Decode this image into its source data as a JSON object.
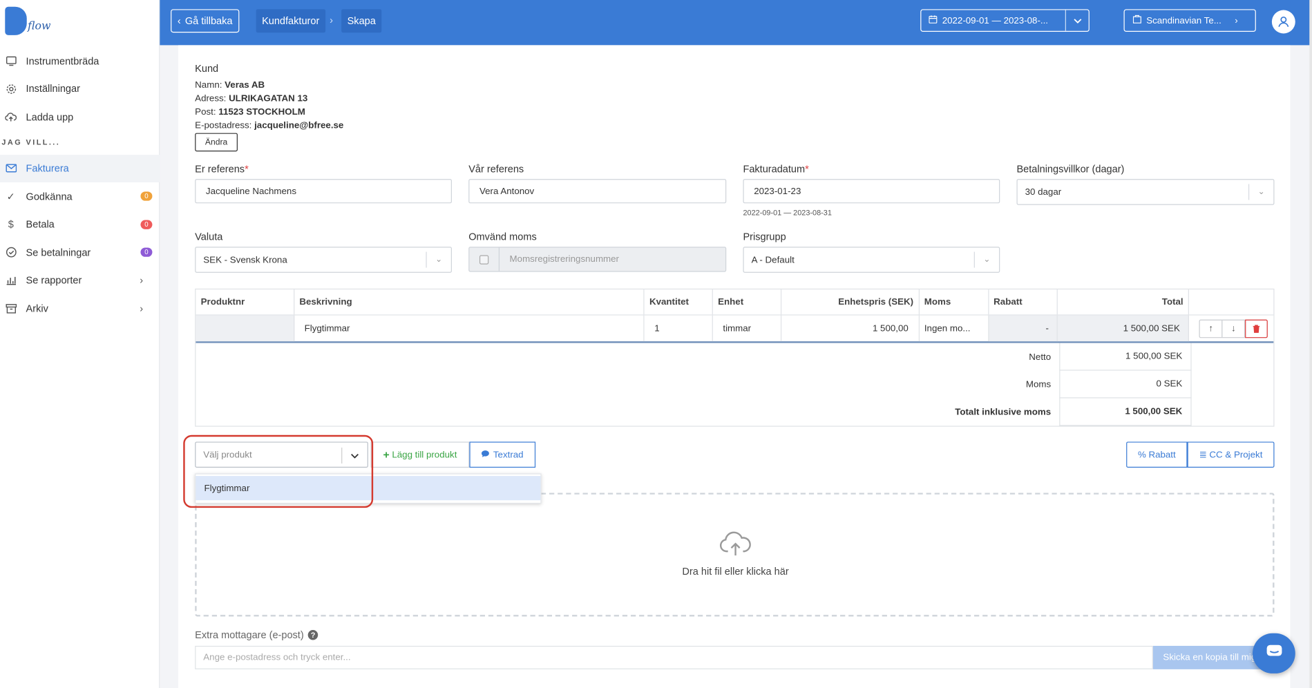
{
  "app": {
    "logo_text": "flow"
  },
  "sidebar": {
    "items": [
      {
        "label": "Instrumentbräda",
        "icon": "monitor-icon"
      },
      {
        "label": "Inställningar",
        "icon": "gear-icon"
      },
      {
        "label": "Ladda upp",
        "icon": "upload-cloud-icon"
      }
    ],
    "section_heading": "JAG VILL...",
    "actions": [
      {
        "label": "Fakturera",
        "icon": "envelope-icon",
        "active": true
      },
      {
        "label": "Godkänna",
        "icon": "check-icon",
        "badge": "0",
        "badge_color": "#f0a23b"
      },
      {
        "label": "Betala",
        "icon": "dollar-icon",
        "badge": "0",
        "badge_color": "#ef5b5b"
      },
      {
        "label": "Se betalningar",
        "icon": "check-circle-icon",
        "badge": "0",
        "badge_color": "#8e5bd6"
      },
      {
        "label": "Se rapporter",
        "icon": "bar-chart-icon",
        "chevron": true
      },
      {
        "label": "Arkiv",
        "icon": "archive-icon",
        "chevron": true
      }
    ]
  },
  "topbar": {
    "back_label": "Gå tillbaka",
    "breadcrumbs": [
      "Kundfakturor",
      "Skapa"
    ],
    "date_range": "2022-09-01 — 2023-08-...",
    "organization": "Scandinavian Te...",
    "accent_color": "#3a7bd5"
  },
  "customer": {
    "title": "Kund",
    "name_label": "Namn:",
    "name": "Veras AB",
    "address_label": "Adress:",
    "address": "ULRIKAGATAN 13",
    "post_label": "Post:",
    "post": "11523 STOCKHOLM",
    "email_label": "E-postadress:",
    "email": "jacqueline@bfree.se",
    "change_label": "Ändra"
  },
  "form": {
    "er_referens": {
      "label": "Er referens",
      "value": "Jacqueline Nachmens"
    },
    "var_referens": {
      "label": "Vår referens",
      "value": "Vera Antonov"
    },
    "fakturadatum": {
      "label": "Fakturadatum",
      "value": "2023-01-23",
      "hint": "2022-09-01 — 2023-08-31"
    },
    "betalningsvillkor": {
      "label": "Betalningsvillkor (dagar)",
      "value": "30 dagar"
    },
    "valuta": {
      "label": "Valuta",
      "value": "SEK - Svensk Krona"
    },
    "omvand_moms": {
      "label": "Omvänd moms",
      "placeholder": "Momsregistreringsnummer"
    },
    "prisgrupp": {
      "label": "Prisgrupp",
      "value": "A - Default"
    }
  },
  "table": {
    "headers": [
      "Produktnr",
      "Beskrivning",
      "Kvantitet",
      "Enhet",
      "Enhetspris (SEK)",
      "Moms",
      "Rabatt",
      "Total"
    ],
    "rows": [
      {
        "produktnr": "",
        "beskrivning": "Flygtimmar",
        "kvantitet": "1",
        "enhet": "timmar",
        "enhetspris": "1 500,00",
        "moms": "Ingen mo...",
        "rabatt": "-",
        "total": "1 500,00 SEK"
      }
    ],
    "totals": [
      {
        "label": "Netto",
        "value": "1 500,00 SEK",
        "bold": false
      },
      {
        "label": "Moms",
        "value": "0 SEK",
        "bold": false
      },
      {
        "label": "Totalt inklusive moms",
        "value": "1 500,00 SEK",
        "bold": true
      }
    ]
  },
  "product_picker": {
    "placeholder": "Välj produkt",
    "options": [
      "Flygtimmar"
    ],
    "add_label": "Lägg till produkt",
    "textrad_label": "Textrad",
    "rabatt_label": "Rabatt",
    "cc_label": "CC & Projekt"
  },
  "upload": {
    "text": "Dra hit fil eller klicka här"
  },
  "extra": {
    "label": "Extra mottagare (e-post)",
    "placeholder": "Ange e-postadress och tryck enter...",
    "copy_label": "Skicka en kopia till mig"
  }
}
